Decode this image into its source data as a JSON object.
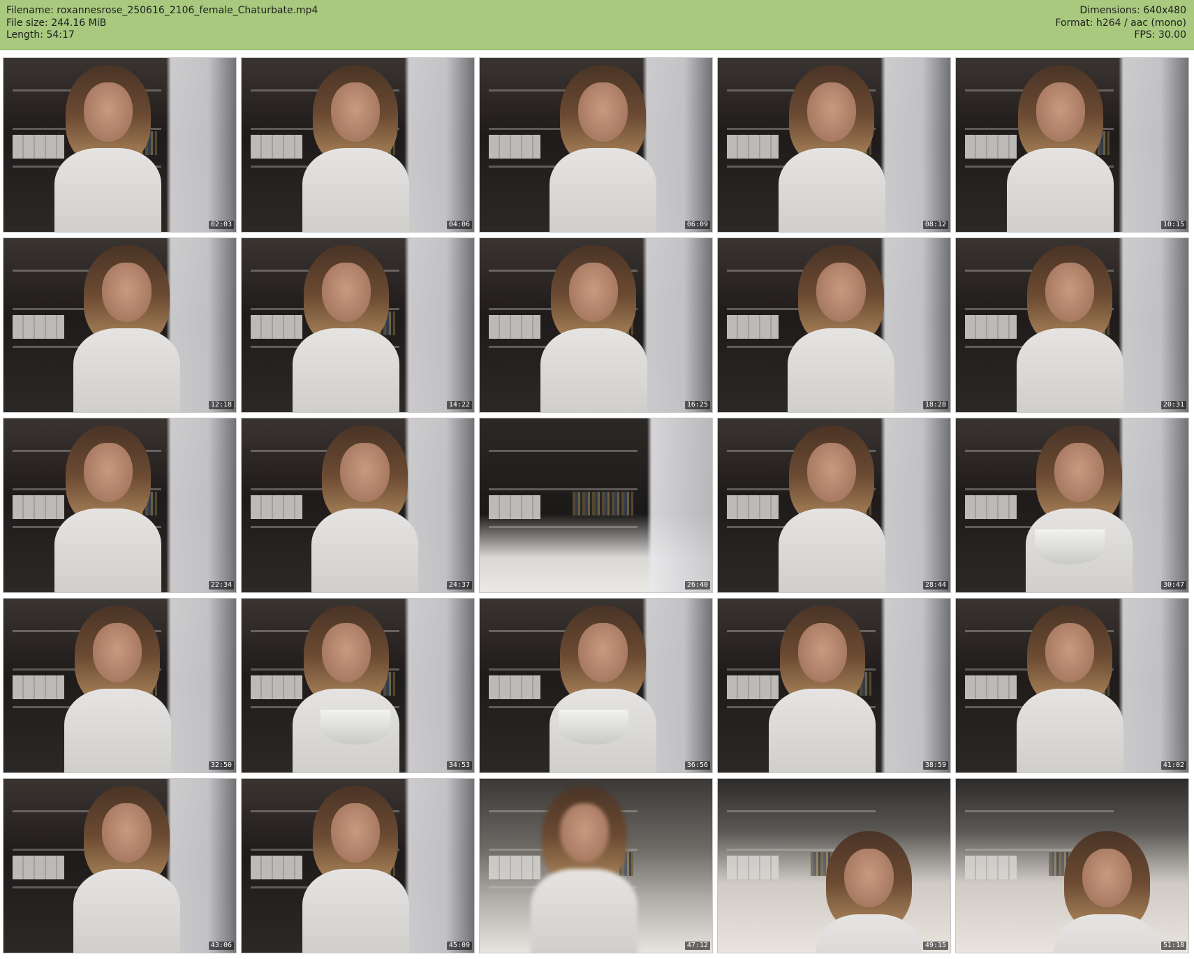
{
  "header": {
    "filename": "Filename: roxannesrose_250616_2106_female_Chaturbate.mp4",
    "file_size": "File size: 244.16 MiB",
    "length": "Length: 54:17",
    "dimensions": "Dimensions: 640x480",
    "format": "Format: h264 / aac (mono)",
    "fps": "FPS: 30.00"
  },
  "colors": {
    "header_background": "#a9c97f",
    "page_background": "#ffffff",
    "timestamp_background": "#000000"
  },
  "thumbnails": [
    {
      "timestamp": "02:03"
    },
    {
      "timestamp": "04:06"
    },
    {
      "timestamp": "06:09"
    },
    {
      "timestamp": "08:12"
    },
    {
      "timestamp": "10:15"
    },
    {
      "timestamp": "12:18"
    },
    {
      "timestamp": "14:22"
    },
    {
      "timestamp": "16:25"
    },
    {
      "timestamp": "18:28"
    },
    {
      "timestamp": "20:31"
    },
    {
      "timestamp": "22:34"
    },
    {
      "timestamp": "24:37"
    },
    {
      "timestamp": "26:40"
    },
    {
      "timestamp": "28:44"
    },
    {
      "timestamp": "30:47"
    },
    {
      "timestamp": "32:50"
    },
    {
      "timestamp": "34:53"
    },
    {
      "timestamp": "36:56"
    },
    {
      "timestamp": "38:59"
    },
    {
      "timestamp": "41:02"
    },
    {
      "timestamp": "43:06"
    },
    {
      "timestamp": "45:09"
    },
    {
      "timestamp": "47:12"
    },
    {
      "timestamp": "49:15"
    },
    {
      "timestamp": "51:18"
    }
  ]
}
